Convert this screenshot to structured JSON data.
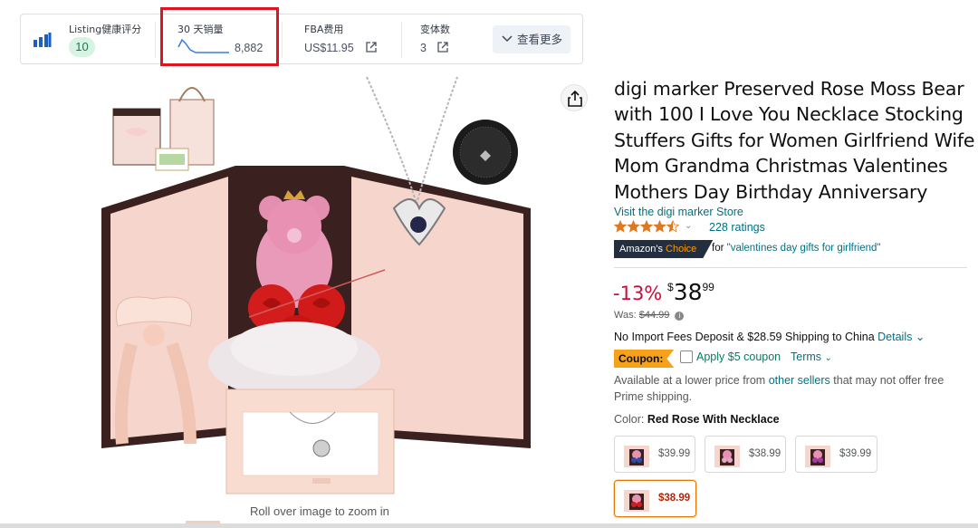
{
  "metrics_bar": {
    "listing_score_label": "Listing健康评分",
    "listing_score_value": "10",
    "sales30_label": "30 天销量",
    "sales30_value": "8,882",
    "fba_label": "FBA费用",
    "fba_value": "US$11.95",
    "variants_label": "变体数",
    "variants_value": "3",
    "more_label": "查看更多"
  },
  "gallery": {
    "zoom_hint": "Roll over image to zoom in"
  },
  "product": {
    "title": "digi marker Preserved Rose Moss Bear with 100 I Love You Necklace Stocking Stuffers Gifts for Women Girlfriend Wife Mom Grandma Christmas Valentines Mothers Day Birthday Anniversary",
    "store_link": "Visit the digi marker Store",
    "rating_value": 4.5,
    "ratings_count": "228 ratings",
    "choice_badge_prefix": "Amazon's",
    "choice_badge_accent": "Choice",
    "choice_for_prefix": "for",
    "choice_query": "\"valentines day gifts for girlfriend\"",
    "discount": "-13%",
    "price_currency": "$",
    "price_whole": "38",
    "price_cents": "99",
    "was_label": "Was:",
    "was_price": "$44.99",
    "shipping_text": "No Import Fees Deposit & $28.59 Shipping to China",
    "shipping_details": "Details",
    "coupon_tag": "Coupon:",
    "coupon_text": "Apply $5 coupon",
    "coupon_terms": "Terms",
    "lower_price_a": "Available at a lower price from",
    "lower_price_link": "other sellers",
    "lower_price_b": "that may not offer free Prime shipping.",
    "color_label": "Color:",
    "color_value": "Red Rose With Necklace",
    "swatches": [
      {
        "price": "$39.99",
        "selected": false
      },
      {
        "price": "$38.99",
        "selected": false
      },
      {
        "price": "$39.99",
        "selected": false
      },
      {
        "price": "$38.99",
        "selected": true
      }
    ]
  },
  "colors": {
    "link": "#007185",
    "discount_red": "#cc0c39",
    "highlight_box": "#e0141e",
    "coupon_orange": "#f7a11a",
    "score_badge_bg": "#d6f3e4"
  }
}
